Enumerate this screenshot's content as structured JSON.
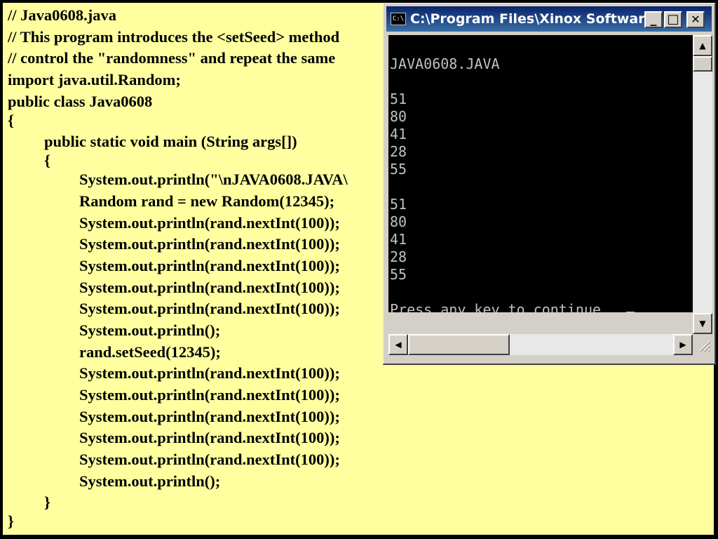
{
  "code": {
    "lines": [
      "// Java0608.java",
      "// This program introduces the <setSeed> method",
      "// control the \"randomness\" and repeat the same",
      "import java.util.Random;",
      "public class Java0608",
      "{",
      "public static void main (String args[])",
      "{",
      "System.out.println(\"\\nJAVA0608.JAVA\\",
      "Random rand = new Random(12345);",
      "System.out.println(rand.nextInt(100));",
      "System.out.println(rand.nextInt(100));",
      "System.out.println(rand.nextInt(100));",
      "System.out.println(rand.nextInt(100));",
      "System.out.println(rand.nextInt(100));",
      "System.out.println();",
      "rand.setSeed(12345);",
      "System.out.println(rand.nextInt(100));",
      "System.out.println(rand.nextInt(100));",
      "System.out.println(rand.nextInt(100));",
      "System.out.println(rand.nextInt(100));",
      "System.out.println(rand.nextInt(100));",
      "System.out.println();",
      "}",
      "}"
    ]
  },
  "console": {
    "icon_label": "C:\\",
    "title": "C:\\Program Files\\Xinox Software...",
    "minimize_label": "_",
    "maximize_label": "□",
    "close_label": "✕",
    "output": [
      "JAVA0608.JAVA",
      "51",
      "80",
      "41",
      "28",
      "55",
      "51",
      "80",
      "41",
      "28",
      "55"
    ],
    "prompt": "Press any key to continue...",
    "scroll_up": "▲",
    "scroll_down": "▼",
    "scroll_left": "◀",
    "scroll_right": "▶"
  }
}
